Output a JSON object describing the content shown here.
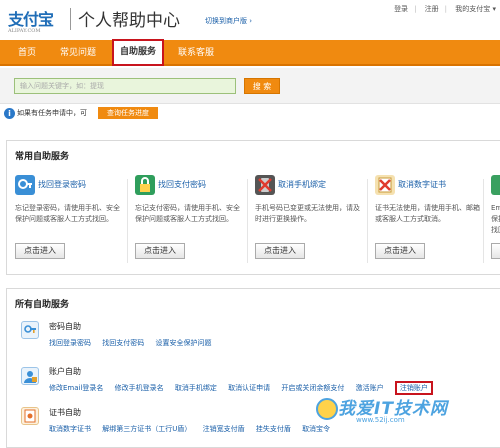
{
  "header": {
    "logo": "支付宝",
    "logo_sub": "ALIPAY.COM",
    "site_title": "个人帮助中心",
    "switch_link": "切换到商户版 ›",
    "links": [
      "登录",
      "注册",
      "我的支付宝 ▾"
    ]
  },
  "nav": {
    "items": [
      "首页",
      "常见问题",
      "自助服务",
      "联系客服"
    ],
    "active_index": 2
  },
  "search": {
    "placeholder": "输入问题关键字，如：提现",
    "button": "搜 索"
  },
  "info": {
    "text": "如果有任务申请中，可",
    "button": "查询任务进度"
  },
  "common_services": {
    "title": "常用自助服务",
    "cards": [
      {
        "title": "找回登录密码",
        "desc": "忘记登录密码，请使用手机、安全保护问题或客服人工方式找回。",
        "button": "点击进入",
        "icon": "key-lock-icon",
        "color": "#3a8fd6"
      },
      {
        "title": "找回支付密码",
        "desc": "忘记支付密码，请使用手机、安全保护问题或客服人工方式找回。",
        "button": "点击进入",
        "icon": "key-lock-icon",
        "color": "#2f9e5c"
      },
      {
        "title": "取消手机绑定",
        "desc": "手机号码已变更或无法使用，请及时进行更换操作。",
        "button": "点击进入",
        "icon": "phone-cancel-icon",
        "color": "#d8473a"
      },
      {
        "title": "取消数字证书",
        "desc": "证书无法使用，请使用手机、邮箱或客服人工方式取消。",
        "button": "点击进入",
        "icon": "certificate-cancel-icon",
        "color": "#e3702b"
      },
      {
        "title": "",
        "desc": "Ema\n保护\n找回",
        "button": "点",
        "icon": "email-icon",
        "color": "#3aa060"
      }
    ]
  },
  "all_services": {
    "title": "所有自助服务",
    "categories": [
      {
        "title": "密码自助",
        "icon": "password-icon",
        "color": "#3a8fd6",
        "links": [
          "找回登录密码",
          "找回支付密码",
          "设置安全保护问题"
        ]
      },
      {
        "title": "账户自助",
        "icon": "account-icon",
        "color": "#3a8fd6",
        "links": [
          "修改Email登录名",
          "修改手机登录名",
          "取消手机绑定",
          "取消认证申请",
          "开启或关闭余额支付",
          "激活账户"
        ],
        "highlight": "注销账户"
      },
      {
        "title": "证书自助",
        "icon": "certificate-icon",
        "color": "#e3702b",
        "links": [
          "取消数字证书",
          "解绑第三方证书（工行U盾）",
          "注销宽支付盾",
          "挂失支付盾",
          "取消宝令"
        ]
      }
    ]
  },
  "watermark": {
    "text": "我爱IT技术网",
    "url": "www.52ij.com"
  }
}
